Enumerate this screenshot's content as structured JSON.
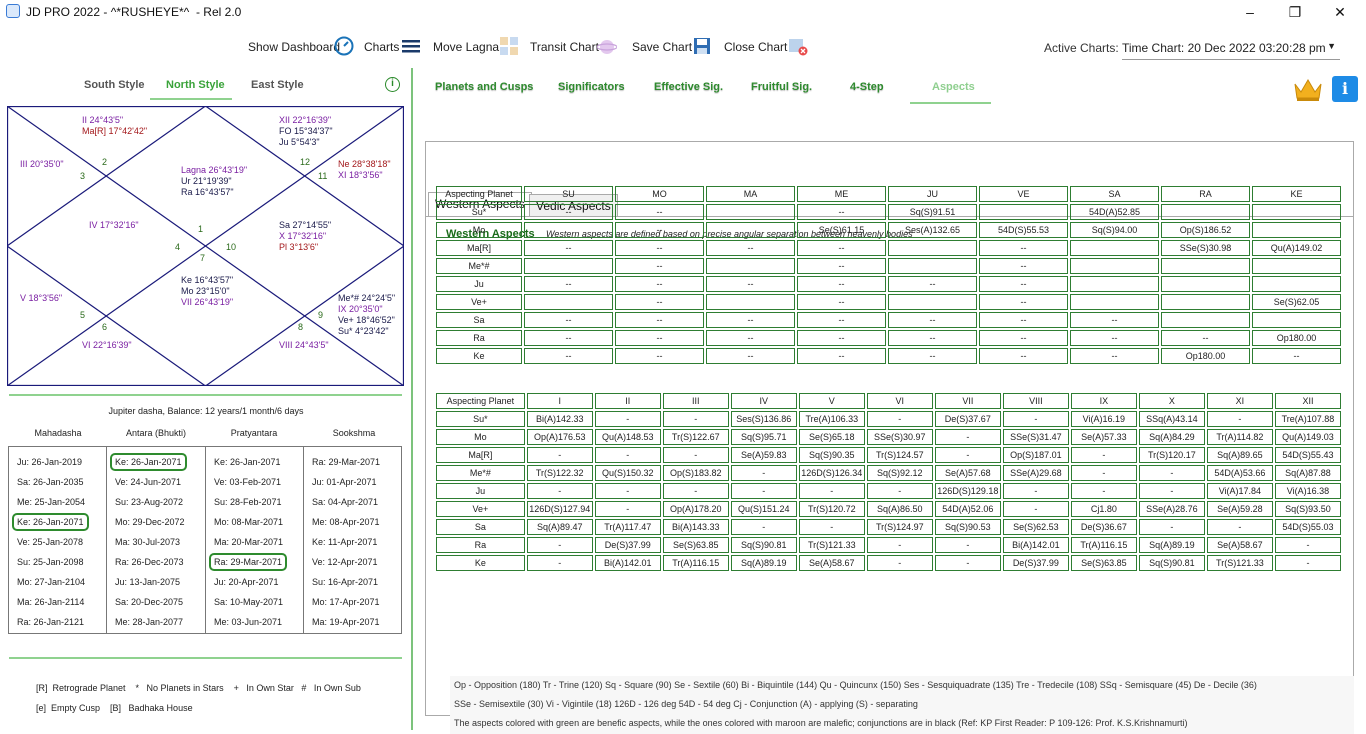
{
  "window": {
    "title": "JD PRO 2022 - ^*RUSHEYE*^  - Rel 2.0",
    "min": "–",
    "max": "❐",
    "close": "✕"
  },
  "toolbar": {
    "dashboard": "Show Dashboard",
    "charts": "Charts",
    "move_lagna": "Move Lagna",
    "transit": "Transit Chart",
    "save": "Save Chart",
    "close": "Close Chart",
    "active_label": "Active Charts:",
    "active_value": "Time Chart: 20 Dec 2022 03:20:28 pm"
  },
  "styles": {
    "south": "South Style",
    "north": "North Style",
    "east": "East Style"
  },
  "chart": {
    "h1": [
      "Lagna  26°43'19\"",
      "Ur 21°19'39\"",
      "Ra 16°43'57\""
    ],
    "h2": [
      "II 24°43'5\"",
      "Ma[R] 17°42'42\""
    ],
    "h3": [
      "III 20°35'0\""
    ],
    "h4": [
      "IV 17°32'16\""
    ],
    "h5": [
      "V 18°3'56\""
    ],
    "h6": [
      "VI 22°16'39\""
    ],
    "h7": [
      "Ke 16°43'57\"",
      "Mo 23°15'0\"",
      "VII 26°43'19\""
    ],
    "h8": [
      "VIII 24°43'5\""
    ],
    "h9": [
      "Me*# 24°24'5\"",
      "IX 20°35'0\"",
      "Ve+ 18°46'52\"",
      "Su* 4°23'42\""
    ],
    "h10": [
      "Sa 27°14'55\"",
      "X 17°32'16\"",
      "Pl 3°13'6\""
    ],
    "h11": [
      "Ne 28°38'18\"",
      "XI 18°3'56\""
    ],
    "h12": [
      "XII 22°16'39\"",
      "FO 15°34'37\"",
      "Ju 5°54'3\""
    ],
    "nums": [
      "1",
      "2",
      "3",
      "4",
      "5",
      "6",
      "7",
      "8",
      "9",
      "10",
      "11",
      "12"
    ]
  },
  "dasha": {
    "title": "Jupiter dasha, Balance: 12 years/1 month/6 days",
    "headers": [
      "Mahadasha",
      "Antara (Bhukti)",
      "Pratyantara",
      "Sookshma"
    ],
    "maha": [
      "Ju: 26-Jan-2019",
      "Sa: 26-Jan-2035",
      "Me: 25-Jan-2054",
      "Ke: 26-Jan-2071",
      "Ve: 25-Jan-2078",
      "Su: 25-Jan-2098",
      "Mo: 27-Jan-2104",
      "Ma: 26-Jan-2114",
      "Ra: 26-Jan-2121"
    ],
    "antara": [
      "Ke: 26-Jan-2071",
      "Ve: 24-Jun-2071",
      "Su: 23-Aug-2072",
      "Mo: 29-Dec-2072",
      "Ma: 30-Jul-2073",
      "Ra: 26-Dec-2073",
      "Ju: 13-Jan-2075",
      "Sa: 20-Dec-2075",
      "Me: 28-Jan-2077"
    ],
    "pratya": [
      "Ke: 26-Jan-2071",
      "Ve: 03-Feb-2071",
      "Su: 28-Feb-2071",
      "Mo: 08-Mar-2071",
      "Ma: 20-Mar-2071",
      "Ra: 29-Mar-2071",
      "Ju: 20-Apr-2071",
      "Sa: 10-May-2071",
      "Me: 03-Jun-2071"
    ],
    "sook": [
      "Ra: 29-Mar-2071",
      "Ju: 01-Apr-2071",
      "Sa: 04-Apr-2071",
      "Me: 08-Apr-2071",
      "Ke: 11-Apr-2071",
      "Ve: 12-Apr-2071",
      "Su: 16-Apr-2071",
      "Mo: 17-Apr-2071",
      "Ma: 19-Apr-2071"
    ]
  },
  "legend": {
    "line1": "[R]  Retrograde Planet    *   No Planets in Stars    +   In Own Star   #   In Own Sub",
    "line2": "[e]  Empty Cusp    [B]   Badhaka House"
  },
  "tabs": [
    "Planets and Cusps",
    "Significators",
    "Effective Sig.",
    "Fruitful Sig.",
    "4-Step",
    "Aspects"
  ],
  "subtabs": [
    "Western Aspects",
    "Vedic Aspects"
  ],
  "wa_title": "Western Aspects",
  "wa_desc": "Western aspects are defined based on precise angular separation between heavenly bodies",
  "planet_table": {
    "header": [
      "Aspecting Planet",
      "SU",
      "MO",
      "MA",
      "ME",
      "JU",
      "VE",
      "SA",
      "RA",
      "KE"
    ],
    "rows": [
      [
        "Su*",
        "--",
        "--",
        "",
        "--",
        {
          "t": "Sq(S)91.51",
          "c": "ma"
        },
        "",
        {
          "t": "54D(A)52.85",
          "c": "gr"
        },
        "",
        ""
      ],
      [
        "Mo",
        "",
        "--",
        "",
        "Se(S)61.15",
        {
          "t": "Ses(A)132.65",
          "c": "ma"
        },
        {
          "t": "54D(S)55.53",
          "c": "gr"
        },
        {
          "t": "Sq(S)94.00",
          "c": "ma"
        },
        {
          "t": "Op(S)186.52",
          "c": "ma"
        },
        ""
      ],
      [
        "Ma[R]",
        "--",
        "--",
        "--",
        "--",
        "",
        "--",
        "",
        {
          "t": "SSe(S)30.98",
          "c": "gr"
        },
        {
          "t": "Qu(A)149.02",
          "c": "ma"
        }
      ],
      [
        "Me*#",
        "",
        "--",
        "",
        "--",
        "",
        "--",
        "",
        "",
        ""
      ],
      [
        "Ju",
        "--",
        "--",
        "--",
        "--",
        "--",
        "--",
        "",
        "",
        ""
      ],
      [
        "Ve+",
        "",
        "--",
        "",
        "--",
        "",
        "--",
        "",
        "",
        {
          "t": "Se(S)62.05",
          "c": "gr"
        }
      ],
      [
        "Sa",
        "--",
        "--",
        "--",
        "--",
        "--",
        "--",
        "--",
        "",
        ""
      ],
      [
        "Ra",
        "--",
        "--",
        "--",
        "--",
        "--",
        "--",
        "--",
        "--",
        {
          "t": "Op180.00",
          "c": "ma"
        }
      ],
      [
        "Ke",
        "--",
        "--",
        "--",
        "--",
        "--",
        "--",
        "--",
        {
          "t": "Op180.00",
          "c": "ma"
        },
        "--"
      ]
    ]
  },
  "house_table": {
    "header": [
      "Aspecting Planet",
      "I",
      "II",
      "III",
      "IV",
      "V",
      "VI",
      "VII",
      "VIII",
      "IX",
      "X",
      "XI",
      "XII"
    ],
    "rows": [
      [
        "Su*",
        {
          "t": "Bi(A)142.33",
          "c": "gr"
        },
        "-",
        "-",
        {
          "t": "Ses(S)136.86",
          "c": "ma"
        },
        {
          "t": "Tre(A)106.33",
          "c": "gr"
        },
        "-",
        {
          "t": "De(S)37.67",
          "c": "gr"
        },
        "-",
        {
          "t": "Vi(A)16.19",
          "c": "gr"
        },
        {
          "t": "SSq(A)43.14",
          "c": "ma"
        },
        "-",
        {
          "t": "Tre(A)107.88",
          "c": "gr"
        }
      ],
      [
        "Mo",
        {
          "t": "Op(A)176.53",
          "c": "ma"
        },
        {
          "t": "Qu(A)148.53",
          "c": "ma"
        },
        {
          "t": "Tr(S)122.67",
          "c": "gr"
        },
        {
          "t": "Sq(S)95.71",
          "c": "ma"
        },
        {
          "t": "Se(S)65.18",
          "c": "gr"
        },
        {
          "t": "SSe(S)30.97",
          "c": "gr"
        },
        "-",
        {
          "t": "SSe(S)31.47",
          "c": "gr"
        },
        {
          "t": "Se(A)57.33",
          "c": "gr"
        },
        {
          "t": "Sq(A)84.29",
          "c": "ma"
        },
        {
          "t": "Tr(A)114.82",
          "c": "gr"
        },
        {
          "t": "Qu(A)149.03",
          "c": "ma"
        }
      ],
      [
        "Ma[R]",
        "-",
        "-",
        "-",
        {
          "t": "Se(A)59.83",
          "c": "gr"
        },
        {
          "t": "Sq(S)90.35",
          "c": "ma"
        },
        {
          "t": "Tr(S)124.57",
          "c": "gr"
        },
        "-",
        {
          "t": "Op(S)187.01",
          "c": "ma"
        },
        "-",
        {
          "t": "Tr(S)120.17",
          "c": "gr"
        },
        {
          "t": "Sq(A)89.65",
          "c": "ma"
        },
        {
          "t": "54D(S)55.43",
          "c": "gr"
        }
      ],
      [
        "Me*#",
        {
          "t": "Tr(S)122.32",
          "c": "gr"
        },
        {
          "t": "Qu(S)150.32",
          "c": "ma"
        },
        {
          "t": "Op(S)183.82",
          "c": "ma"
        },
        "-",
        {
          "t": "126D(S)126.34",
          "c": "gr"
        },
        {
          "t": "Sq(S)92.12",
          "c": "ma"
        },
        {
          "t": "Se(A)57.68",
          "c": "gr"
        },
        {
          "t": "SSe(A)29.68",
          "c": "gr"
        },
        "-",
        "-",
        {
          "t": "54D(A)53.66",
          "c": "gr"
        },
        {
          "t": "Sq(A)87.88",
          "c": "ma"
        }
      ],
      [
        "Ju",
        "-",
        "-",
        "-",
        "-",
        "-",
        "-",
        {
          "t": "126D(S)129.18",
          "c": "gr"
        },
        "-",
        "-",
        "-",
        {
          "t": "Vi(A)17.84",
          "c": "gr"
        },
        {
          "t": "Vi(A)16.38",
          "c": "gr"
        }
      ],
      [
        "Ve+",
        {
          "t": "126D(S)127.94",
          "c": "gr"
        },
        "-",
        {
          "t": "Op(A)178.20",
          "c": "ma"
        },
        {
          "t": "Qu(S)151.24",
          "c": "ma"
        },
        {
          "t": "Tr(S)120.72",
          "c": "gr"
        },
        {
          "t": "Sq(A)86.50",
          "c": "ma"
        },
        {
          "t": "54D(A)52.06",
          "c": "gr"
        },
        "-",
        {
          "t": "Cj1.80",
          "c": "bl"
        },
        {
          "t": "SSe(A)28.76",
          "c": "gr"
        },
        {
          "t": "Se(A)59.28",
          "c": "gr"
        },
        {
          "t": "Sq(S)93.50",
          "c": "ma"
        }
      ],
      [
        "Sa",
        {
          "t": "Sq(A)89.47",
          "c": "ma"
        },
        {
          "t": "Tr(A)117.47",
          "c": "gr"
        },
        {
          "t": "Bi(A)143.33",
          "c": "gr"
        },
        "-",
        "-",
        {
          "t": "Tr(S)124.97",
          "c": "gr"
        },
        {
          "t": "Sq(S)90.53",
          "c": "ma"
        },
        {
          "t": "Se(S)62.53",
          "c": "gr"
        },
        {
          "t": "De(S)36.67",
          "c": "gr"
        },
        "-",
        "-",
        {
          "t": "54D(S)55.03",
          "c": "gr"
        }
      ],
      [
        "Ra",
        "-",
        {
          "t": "De(S)37.99",
          "c": "gr"
        },
        {
          "t": "Se(S)63.85",
          "c": "gr"
        },
        {
          "t": "Sq(S)90.81",
          "c": "ma"
        },
        {
          "t": "Tr(S)121.33",
          "c": "gr"
        },
        "-",
        "-",
        {
          "t": "Bi(A)142.01",
          "c": "gr"
        },
        {
          "t": "Tr(A)116.15",
          "c": "gr"
        },
        {
          "t": "Sq(A)89.19",
          "c": "ma"
        },
        {
          "t": "Se(A)58.67",
          "c": "gr"
        },
        "-"
      ],
      [
        "Ke",
        "-",
        {
          "t": "Bi(A)142.01",
          "c": "gr"
        },
        {
          "t": "Tr(A)116.15",
          "c": "gr"
        },
        {
          "t": "Sq(A)89.19",
          "c": "ma"
        },
        {
          "t": "Se(A)58.67",
          "c": "gr"
        },
        "-",
        "-",
        {
          "t": "De(S)37.99",
          "c": "gr"
        },
        {
          "t": "Se(S)63.85",
          "c": "gr"
        },
        {
          "t": "Sq(S)90.81",
          "c": "ma"
        },
        {
          "t": "Tr(S)121.33",
          "c": "gr"
        },
        "-"
      ]
    ]
  },
  "abbr": {
    "line1": "Op - Opposition (180)   Tr - Trine (120)   Sq - Square (90)   Se - Sextile (60)   Bi - Biquintile (144)   Qu - Quincunx (150)   Ses - Sesquiquadrate (135)   Tre - Tredecile (108)   SSq - Semisquare (45)   De - Decile (36)",
    "line2": "SSe - Semisextile (30)   Vi - Vigintile (18)   126D - 126 deg   54D - 54 deg   Cj - Conjunction   (A) - applying   (S) - separating",
    "line3": "The aspects colored with green are benefic aspects, while the ones colored with maroon are malefic; conjunctions are in black    (Ref: KP First Reader: P 109-126: Prof. K.S.Krishnamurti)"
  },
  "colors": {
    "benefic": "#1f7a1f",
    "malefic": "#a3181b",
    "conjunction": "#111111",
    "accent": "#2e8b2e"
  }
}
